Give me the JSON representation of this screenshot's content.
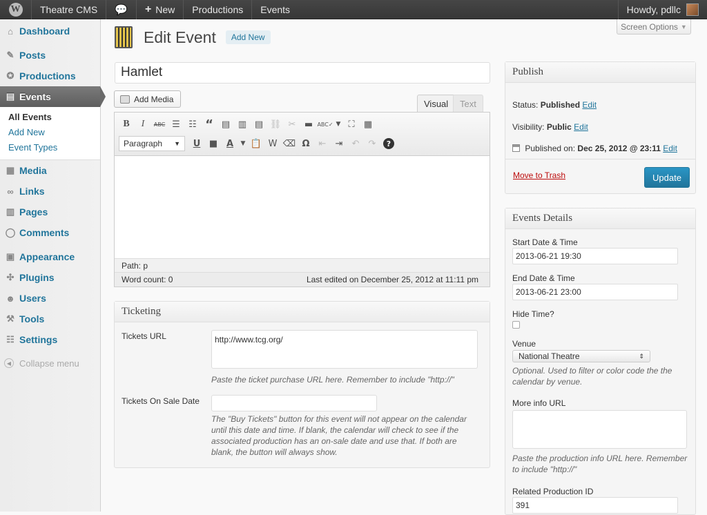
{
  "adminbar": {
    "site_name": "Theatre CMS",
    "new_label": "New",
    "productions_label": "Productions",
    "events_label": "Events",
    "howdy": "Howdy, pdllc"
  },
  "sidebar": {
    "items": [
      {
        "label": "Dashboard",
        "icon": "dashboard-icon"
      },
      {
        "label": "Posts",
        "icon": "pin-icon"
      },
      {
        "label": "Productions",
        "icon": "productions-icon"
      },
      {
        "label": "Events",
        "icon": "events-icon"
      },
      {
        "label": "Media",
        "icon": "media-icon"
      },
      {
        "label": "Links",
        "icon": "links-icon"
      },
      {
        "label": "Pages",
        "icon": "pages-icon"
      },
      {
        "label": "Comments",
        "icon": "comments-icon"
      },
      {
        "label": "Appearance",
        "icon": "appearance-icon"
      },
      {
        "label": "Plugins",
        "icon": "plugins-icon"
      },
      {
        "label": "Users",
        "icon": "users-icon"
      },
      {
        "label": "Tools",
        "icon": "tools-icon"
      },
      {
        "label": "Settings",
        "icon": "settings-icon"
      }
    ],
    "submenu": [
      "All Events",
      "Add New",
      "Event Types"
    ],
    "collapse": "Collapse menu"
  },
  "screen_options": "Screen Options",
  "page": {
    "title": "Edit Event",
    "add_new": "Add New",
    "post_title": "Hamlet"
  },
  "editor": {
    "add_media": "Add Media",
    "tab_visual": "Visual",
    "tab_text": "Text",
    "format": "Paragraph",
    "path": "Path: p",
    "word_count": "Word count: 0",
    "last_edited": "Last edited on December 25, 2012 at 11:11 pm"
  },
  "ticketing": {
    "heading": "Ticketing",
    "url_label": "Tickets URL",
    "url_value": "http://www.tcg.org/",
    "url_desc": "Paste the ticket purchase URL here. Remember to include \"http://\"",
    "sale_label": "Tickets On Sale Date",
    "sale_value": "",
    "sale_desc": "The \"Buy Tickets\" button for this event will not appear on the calendar until this date and time. If blank, the calendar will check to see if the associated production has an on-sale date and use that. If both are blank, the button will always show."
  },
  "publish": {
    "heading": "Publish",
    "status_label": "Status:",
    "status_value": "Published",
    "visibility_label": "Visibility:",
    "visibility_value": "Public",
    "edit": "Edit",
    "published_label": "Published on:",
    "published_value": "Dec 25, 2012 @ 23:11",
    "trash": "Move to Trash",
    "update": "Update"
  },
  "events_details": {
    "heading": "Events Details",
    "start_label": "Start Date & Time",
    "start_value": "2013-06-21 19:30",
    "end_label": "End Date & Time",
    "end_value": "2013-06-21 23:00",
    "hide_time_label": "Hide Time?",
    "venue_label": "Venue",
    "venue_value": "National Theatre",
    "venue_desc": "Optional. Used to filter or color code the the calendar by venue.",
    "more_info_label": "More info URL",
    "more_info_desc": "Paste the production info URL here. Remember to include \"http://\"",
    "related_label": "Related Production ID",
    "related_value": "391"
  },
  "colors": {
    "link": "#21759b",
    "current_menu": "#6a6a6a",
    "trash": "#bc0b0b",
    "primary_button": "#2a95c5"
  }
}
